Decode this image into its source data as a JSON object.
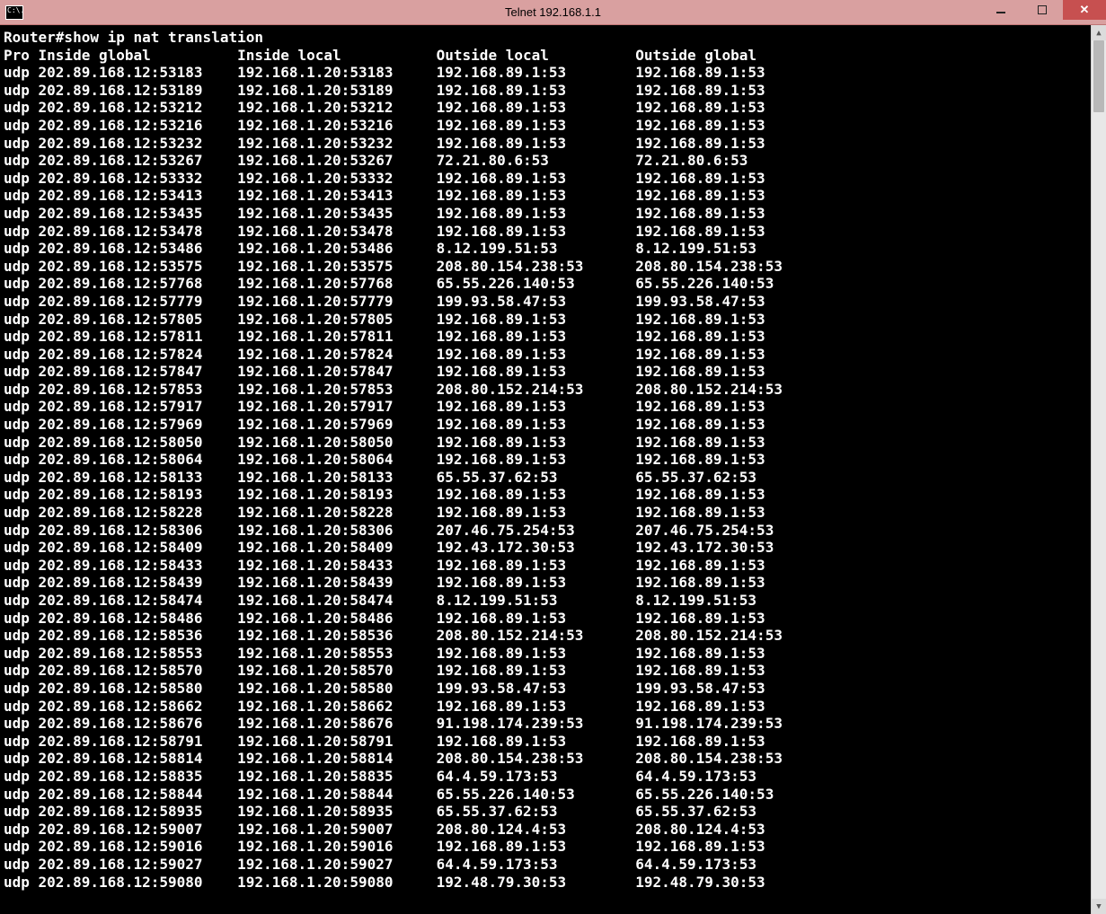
{
  "window": {
    "title": "Telnet 192.168.1.1",
    "sys_label": "C:\\."
  },
  "prompt": "Router#show ip nat translation",
  "headers": {
    "pro": "Pro",
    "ig": "Inside global",
    "il": "Inside local",
    "ol": "Outside local",
    "og": "Outside global"
  },
  "rows": [
    {
      "p": "udp",
      "ig": "202.89.168.12:53183",
      "il": "192.168.1.20:53183",
      "ol": "192.168.89.1:53",
      "og": "192.168.89.1:53"
    },
    {
      "p": "udp",
      "ig": "202.89.168.12:53189",
      "il": "192.168.1.20:53189",
      "ol": "192.168.89.1:53",
      "og": "192.168.89.1:53"
    },
    {
      "p": "udp",
      "ig": "202.89.168.12:53212",
      "il": "192.168.1.20:53212",
      "ol": "192.168.89.1:53",
      "og": "192.168.89.1:53"
    },
    {
      "p": "udp",
      "ig": "202.89.168.12:53216",
      "il": "192.168.1.20:53216",
      "ol": "192.168.89.1:53",
      "og": "192.168.89.1:53"
    },
    {
      "p": "udp",
      "ig": "202.89.168.12:53232",
      "il": "192.168.1.20:53232",
      "ol": "192.168.89.1:53",
      "og": "192.168.89.1:53"
    },
    {
      "p": "udp",
      "ig": "202.89.168.12:53267",
      "il": "192.168.1.20:53267",
      "ol": "72.21.80.6:53",
      "og": "72.21.80.6:53"
    },
    {
      "p": "udp",
      "ig": "202.89.168.12:53332",
      "il": "192.168.1.20:53332",
      "ol": "192.168.89.1:53",
      "og": "192.168.89.1:53"
    },
    {
      "p": "udp",
      "ig": "202.89.168.12:53413",
      "il": "192.168.1.20:53413",
      "ol": "192.168.89.1:53",
      "og": "192.168.89.1:53"
    },
    {
      "p": "udp",
      "ig": "202.89.168.12:53435",
      "il": "192.168.1.20:53435",
      "ol": "192.168.89.1:53",
      "og": "192.168.89.1:53"
    },
    {
      "p": "udp",
      "ig": "202.89.168.12:53478",
      "il": "192.168.1.20:53478",
      "ol": "192.168.89.1:53",
      "og": "192.168.89.1:53"
    },
    {
      "p": "udp",
      "ig": "202.89.168.12:53486",
      "il": "192.168.1.20:53486",
      "ol": "8.12.199.51:53",
      "og": "8.12.199.51:53"
    },
    {
      "p": "udp",
      "ig": "202.89.168.12:53575",
      "il": "192.168.1.20:53575",
      "ol": "208.80.154.238:53",
      "og": "208.80.154.238:53"
    },
    {
      "p": "udp",
      "ig": "202.89.168.12:57768",
      "il": "192.168.1.20:57768",
      "ol": "65.55.226.140:53",
      "og": "65.55.226.140:53"
    },
    {
      "p": "udp",
      "ig": "202.89.168.12:57779",
      "il": "192.168.1.20:57779",
      "ol": "199.93.58.47:53",
      "og": "199.93.58.47:53"
    },
    {
      "p": "udp",
      "ig": "202.89.168.12:57805",
      "il": "192.168.1.20:57805",
      "ol": "192.168.89.1:53",
      "og": "192.168.89.1:53"
    },
    {
      "p": "udp",
      "ig": "202.89.168.12:57811",
      "il": "192.168.1.20:57811",
      "ol": "192.168.89.1:53",
      "og": "192.168.89.1:53"
    },
    {
      "p": "udp",
      "ig": "202.89.168.12:57824",
      "il": "192.168.1.20:57824",
      "ol": "192.168.89.1:53",
      "og": "192.168.89.1:53"
    },
    {
      "p": "udp",
      "ig": "202.89.168.12:57847",
      "il": "192.168.1.20:57847",
      "ol": "192.168.89.1:53",
      "og": "192.168.89.1:53"
    },
    {
      "p": "udp",
      "ig": "202.89.168.12:57853",
      "il": "192.168.1.20:57853",
      "ol": "208.80.152.214:53",
      "og": "208.80.152.214:53"
    },
    {
      "p": "udp",
      "ig": "202.89.168.12:57917",
      "il": "192.168.1.20:57917",
      "ol": "192.168.89.1:53",
      "og": "192.168.89.1:53"
    },
    {
      "p": "udp",
      "ig": "202.89.168.12:57969",
      "il": "192.168.1.20:57969",
      "ol": "192.168.89.1:53",
      "og": "192.168.89.1:53"
    },
    {
      "p": "udp",
      "ig": "202.89.168.12:58050",
      "il": "192.168.1.20:58050",
      "ol": "192.168.89.1:53",
      "og": "192.168.89.1:53"
    },
    {
      "p": "udp",
      "ig": "202.89.168.12:58064",
      "il": "192.168.1.20:58064",
      "ol": "192.168.89.1:53",
      "og": "192.168.89.1:53"
    },
    {
      "p": "udp",
      "ig": "202.89.168.12:58133",
      "il": "192.168.1.20:58133",
      "ol": "65.55.37.62:53",
      "og": "65.55.37.62:53"
    },
    {
      "p": "udp",
      "ig": "202.89.168.12:58193",
      "il": "192.168.1.20:58193",
      "ol": "192.168.89.1:53",
      "og": "192.168.89.1:53"
    },
    {
      "p": "udp",
      "ig": "202.89.168.12:58228",
      "il": "192.168.1.20:58228",
      "ol": "192.168.89.1:53",
      "og": "192.168.89.1:53"
    },
    {
      "p": "udp",
      "ig": "202.89.168.12:58306",
      "il": "192.168.1.20:58306",
      "ol": "207.46.75.254:53",
      "og": "207.46.75.254:53"
    },
    {
      "p": "udp",
      "ig": "202.89.168.12:58409",
      "il": "192.168.1.20:58409",
      "ol": "192.43.172.30:53",
      "og": "192.43.172.30:53"
    },
    {
      "p": "udp",
      "ig": "202.89.168.12:58433",
      "il": "192.168.1.20:58433",
      "ol": "192.168.89.1:53",
      "og": "192.168.89.1:53"
    },
    {
      "p": "udp",
      "ig": "202.89.168.12:58439",
      "il": "192.168.1.20:58439",
      "ol": "192.168.89.1:53",
      "og": "192.168.89.1:53"
    },
    {
      "p": "udp",
      "ig": "202.89.168.12:58474",
      "il": "192.168.1.20:58474",
      "ol": "8.12.199.51:53",
      "og": "8.12.199.51:53"
    },
    {
      "p": "udp",
      "ig": "202.89.168.12:58486",
      "il": "192.168.1.20:58486",
      "ol": "192.168.89.1:53",
      "og": "192.168.89.1:53"
    },
    {
      "p": "udp",
      "ig": "202.89.168.12:58536",
      "il": "192.168.1.20:58536",
      "ol": "208.80.152.214:53",
      "og": "208.80.152.214:53"
    },
    {
      "p": "udp",
      "ig": "202.89.168.12:58553",
      "il": "192.168.1.20:58553",
      "ol": "192.168.89.1:53",
      "og": "192.168.89.1:53"
    },
    {
      "p": "udp",
      "ig": "202.89.168.12:58570",
      "il": "192.168.1.20:58570",
      "ol": "192.168.89.1:53",
      "og": "192.168.89.1:53"
    },
    {
      "p": "udp",
      "ig": "202.89.168.12:58580",
      "il": "192.168.1.20:58580",
      "ol": "199.93.58.47:53",
      "og": "199.93.58.47:53"
    },
    {
      "p": "udp",
      "ig": "202.89.168.12:58662",
      "il": "192.168.1.20:58662",
      "ol": "192.168.89.1:53",
      "og": "192.168.89.1:53"
    },
    {
      "p": "udp",
      "ig": "202.89.168.12:58676",
      "il": "192.168.1.20:58676",
      "ol": "91.198.174.239:53",
      "og": "91.198.174.239:53"
    },
    {
      "p": "udp",
      "ig": "202.89.168.12:58791",
      "il": "192.168.1.20:58791",
      "ol": "192.168.89.1:53",
      "og": "192.168.89.1:53"
    },
    {
      "p": "udp",
      "ig": "202.89.168.12:58814",
      "il": "192.168.1.20:58814",
      "ol": "208.80.154.238:53",
      "og": "208.80.154.238:53"
    },
    {
      "p": "udp",
      "ig": "202.89.168.12:58835",
      "il": "192.168.1.20:58835",
      "ol": "64.4.59.173:53",
      "og": "64.4.59.173:53"
    },
    {
      "p": "udp",
      "ig": "202.89.168.12:58844",
      "il": "192.168.1.20:58844",
      "ol": "65.55.226.140:53",
      "og": "65.55.226.140:53"
    },
    {
      "p": "udp",
      "ig": "202.89.168.12:58935",
      "il": "192.168.1.20:58935",
      "ol": "65.55.37.62:53",
      "og": "65.55.37.62:53"
    },
    {
      "p": "udp",
      "ig": "202.89.168.12:59007",
      "il": "192.168.1.20:59007",
      "ol": "208.80.124.4:53",
      "og": "208.80.124.4:53"
    },
    {
      "p": "udp",
      "ig": "202.89.168.12:59016",
      "il": "192.168.1.20:59016",
      "ol": "192.168.89.1:53",
      "og": "192.168.89.1:53"
    },
    {
      "p": "udp",
      "ig": "202.89.168.12:59027",
      "il": "192.168.1.20:59027",
      "ol": "64.4.59.173:53",
      "og": "64.4.59.173:53"
    },
    {
      "p": "udp",
      "ig": "202.89.168.12:59080",
      "il": "192.168.1.20:59080",
      "ol": "192.48.79.30:53",
      "og": "192.48.79.30:53"
    }
  ]
}
